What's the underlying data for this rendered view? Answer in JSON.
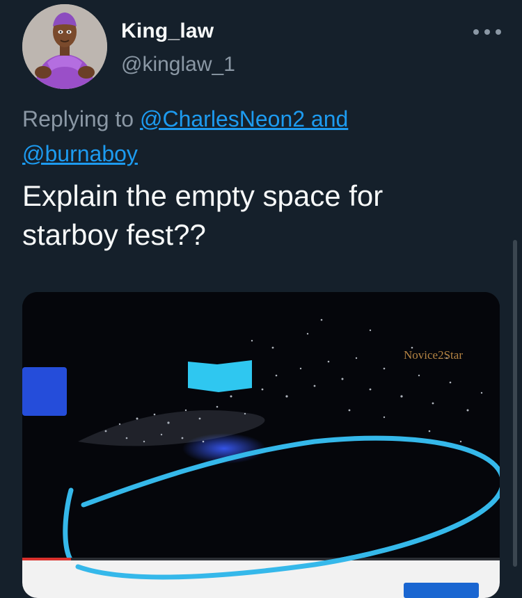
{
  "author": {
    "display_name": "King_law",
    "handle": "@kinglaw_1",
    "avatar_icon": "cartoon-avatar"
  },
  "reply": {
    "prefix": "Replying to",
    "mention_1": "@CharlesNeon2",
    "conjunction": "and",
    "mention_2": "@burnaboy"
  },
  "tweet": {
    "text_line_1": "Explain the empty space for",
    "text_line_2": "starboy fest??"
  },
  "media": {
    "watermark": "Novice2Star",
    "annotation_color": "#35b8ea"
  },
  "colors": {
    "background": "#15202b",
    "primary_text": "#f7f9f9",
    "secondary_text": "#8b98a5",
    "link": "#1d9bf0"
  }
}
